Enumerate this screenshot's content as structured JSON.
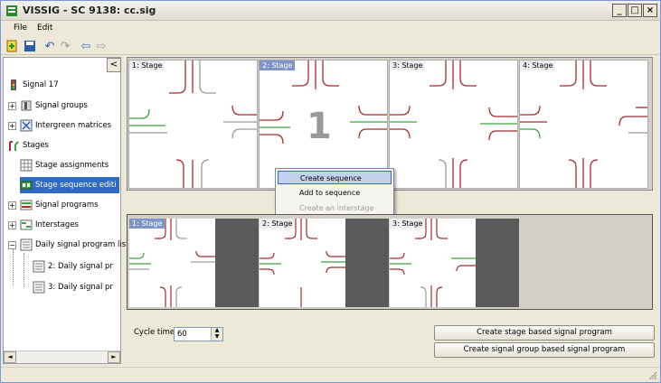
{
  "window": {
    "title": "VISSIG - SC 9138: cc.sig",
    "minimize": "_",
    "maximize": "□",
    "close": "×"
  },
  "menu": {
    "items": [
      "File",
      "Edit"
    ]
  },
  "toolbar": {
    "icons": [
      "new-icon",
      "save-icon",
      "undo-icon",
      "redo-icon",
      "back-icon",
      "forward-icon"
    ]
  },
  "sidebar": {
    "collapse": "<",
    "items": [
      {
        "label": "Signal 17",
        "icon": "controller-icon",
        "expander": ""
      },
      {
        "label": "Signal groups",
        "icon": "signal-groups-icon",
        "expander": "+"
      },
      {
        "label": "Intergreen matrices",
        "icon": "matrix-icon",
        "expander": "+"
      },
      {
        "label": "Stages",
        "icon": "stages-icon",
        "expander": ""
      },
      {
        "label": "Stage assignments",
        "icon": "grid-icon",
        "expander": ""
      },
      {
        "label": "Stage sequence editi",
        "icon": "sequence-icon",
        "expander": ""
      },
      {
        "label": "Signal programs",
        "icon": "program-icon",
        "expander": "+"
      },
      {
        "label": "Interstages",
        "icon": "interstage-icon",
        "expander": "+"
      },
      {
        "label": "Daily signal program list",
        "icon": "list-icon",
        "expander": "−"
      },
      {
        "label": "2: Daily signal pr",
        "icon": "list-icon",
        "expander": ""
      },
      {
        "label": "3: Daily signal pr",
        "icon": "list-icon",
        "expander": ""
      }
    ],
    "scroll_left": "◄",
    "scroll_right": "►"
  },
  "stages": [
    {
      "label": "1: Stage",
      "active": false
    },
    {
      "label": "2: Stage",
      "active": true,
      "number": "1"
    },
    {
      "label": "3: Stage",
      "active": false
    },
    {
      "label": "4: Stage",
      "active": false
    }
  ],
  "sequence": [
    {
      "label": "1: Stage",
      "active": true
    },
    {
      "label": "2: Stage",
      "active": false
    },
    {
      "label": "3: Stage",
      "active": false
    }
  ],
  "context_menu": {
    "items": [
      {
        "label": "Create sequence",
        "state": "highlighted"
      },
      {
        "label": "Add to sequence",
        "state": "enabled"
      },
      {
        "label": "Create an interstage",
        "state": "disabled"
      }
    ]
  },
  "cycle": {
    "label": "Cycle time:",
    "value": "60"
  },
  "buttons": {
    "stage_based": "Create stage based signal program",
    "group_based": "Create signal group based signal program"
  },
  "colors": {
    "green": "#3aa33a",
    "red": "#a52a2a",
    "gray": "#9a9a9a",
    "selection": "#316ac5"
  }
}
